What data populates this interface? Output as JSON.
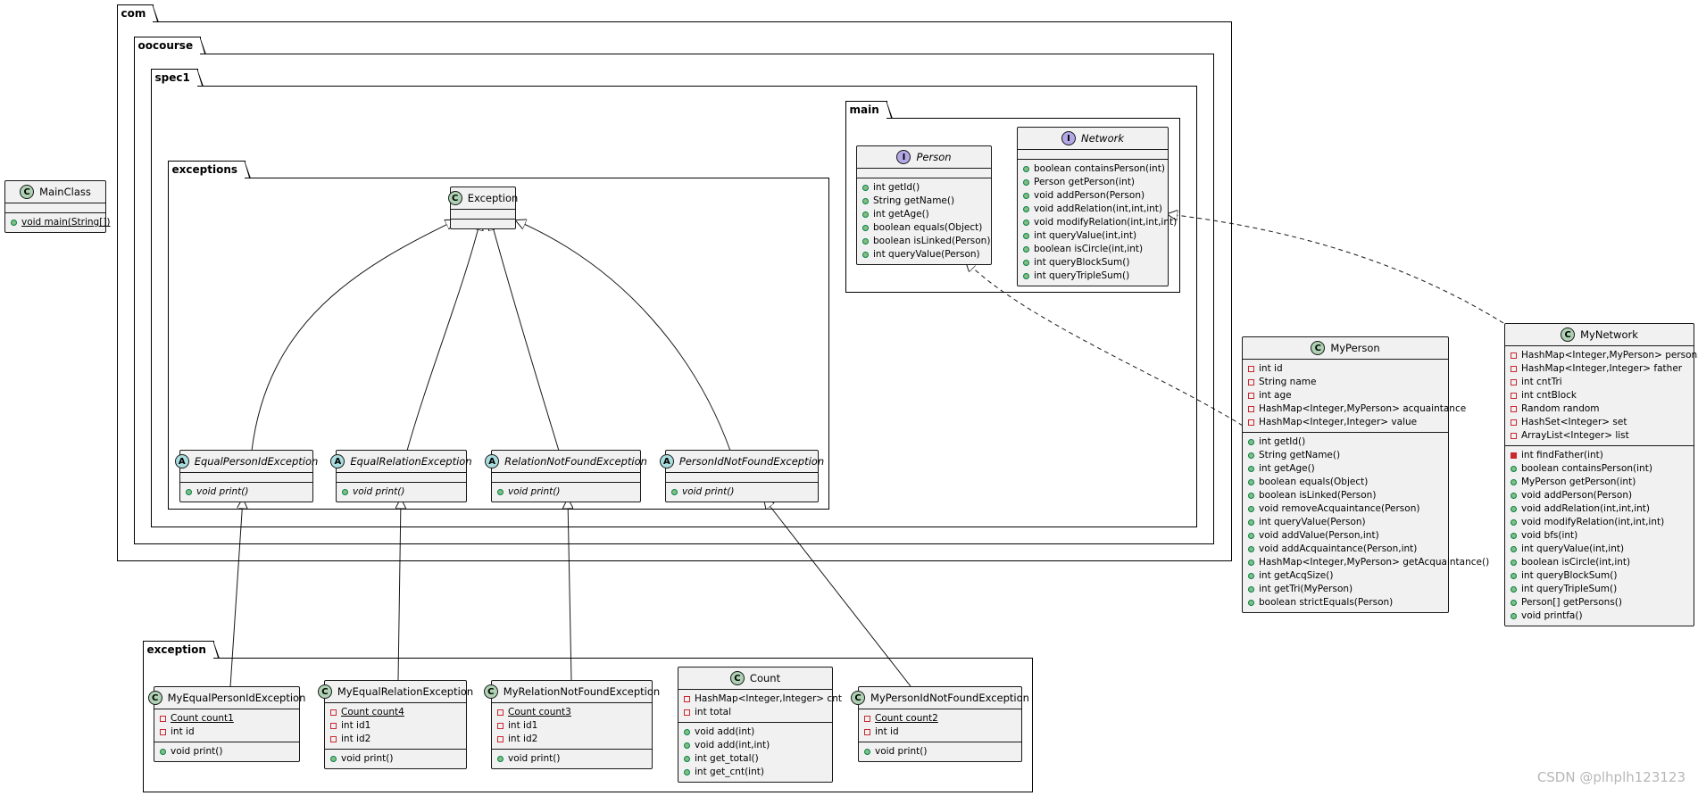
{
  "packages": {
    "com": "com",
    "oocourse": "oocourse",
    "spec1": "spec1",
    "main": "main",
    "exceptions": "exceptions",
    "exception": "exception"
  },
  "classes": {
    "main_class": {
      "kind": "C",
      "name": "MainClass",
      "fields": [],
      "methods": [
        {
          "vis": "pub",
          "text": "void main(String[])",
          "static": true
        }
      ]
    },
    "exception_base": {
      "kind": "C",
      "name": "Exception",
      "fields": [],
      "methods": []
    },
    "person": {
      "kind": "I",
      "name": "Person",
      "fields": [],
      "methods": [
        {
          "vis": "pub",
          "text": "int getId()"
        },
        {
          "vis": "pub",
          "text": "String getName()"
        },
        {
          "vis": "pub",
          "text": "int getAge()"
        },
        {
          "vis": "pub",
          "text": "boolean equals(Object)"
        },
        {
          "vis": "pub",
          "text": "boolean isLinked(Person)"
        },
        {
          "vis": "pub",
          "text": "int queryValue(Person)"
        }
      ]
    },
    "network": {
      "kind": "I",
      "name": "Network",
      "fields": [],
      "methods": [
        {
          "vis": "pub",
          "text": "boolean containsPerson(int)"
        },
        {
          "vis": "pub",
          "text": "Person getPerson(int)"
        },
        {
          "vis": "pub",
          "text": "void addPerson(Person)"
        },
        {
          "vis": "pub",
          "text": "void addRelation(int,int,int)"
        },
        {
          "vis": "pub",
          "text": "void modifyRelation(int,int,int)"
        },
        {
          "vis": "pub",
          "text": "int queryValue(int,int)"
        },
        {
          "vis": "pub",
          "text": "boolean isCircle(int,int)"
        },
        {
          "vis": "pub",
          "text": "int queryBlockSum()"
        },
        {
          "vis": "pub",
          "text": "int queryTripleSum()"
        }
      ]
    },
    "equal_person_id_exception": {
      "kind": "A",
      "name": "EqualPersonIdException",
      "fields": [],
      "methods": [
        {
          "vis": "pub",
          "text": "void print()",
          "abstract": true
        }
      ]
    },
    "equal_relation_exception": {
      "kind": "A",
      "name": "EqualRelationException",
      "fields": [],
      "methods": [
        {
          "vis": "pub",
          "text": "void print()",
          "abstract": true
        }
      ]
    },
    "relation_not_found_exception": {
      "kind": "A",
      "name": "RelationNotFoundException",
      "fields": [],
      "methods": [
        {
          "vis": "pub",
          "text": "void print()",
          "abstract": true
        }
      ]
    },
    "person_id_not_found_exception": {
      "kind": "A",
      "name": "PersonIdNotFoundException",
      "fields": [],
      "methods": [
        {
          "vis": "pub",
          "text": "void print()",
          "abstract": true
        }
      ]
    },
    "my_person": {
      "kind": "C",
      "name": "MyPerson",
      "fields": [
        {
          "vis": "priv",
          "text": "int id"
        },
        {
          "vis": "priv",
          "text": "String name"
        },
        {
          "vis": "priv",
          "text": "int age"
        },
        {
          "vis": "priv",
          "text": "HashMap<Integer,MyPerson> acquaintance"
        },
        {
          "vis": "priv",
          "text": "HashMap<Integer,Integer> value"
        }
      ],
      "methods": [
        {
          "vis": "pub",
          "text": "int getId()"
        },
        {
          "vis": "pub",
          "text": "String getName()"
        },
        {
          "vis": "pub",
          "text": "int getAge()"
        },
        {
          "vis": "pub",
          "text": "boolean equals(Object)"
        },
        {
          "vis": "pub",
          "text": "boolean isLinked(Person)"
        },
        {
          "vis": "pub",
          "text": "void removeAcquaintance(Person)"
        },
        {
          "vis": "pub",
          "text": "int queryValue(Person)"
        },
        {
          "vis": "pub",
          "text": "void addValue(Person,int)"
        },
        {
          "vis": "pub",
          "text": "void addAcquaintance(Person,int)"
        },
        {
          "vis": "pub",
          "text": "HashMap<Integer,MyPerson> getAcquaintance()"
        },
        {
          "vis": "pub",
          "text": "int getAcqSize()"
        },
        {
          "vis": "pub",
          "text": "int getTri(MyPerson)"
        },
        {
          "vis": "pub",
          "text": "boolean strictEquals(Person)"
        }
      ]
    },
    "my_network": {
      "kind": "C",
      "name": "MyNetwork",
      "fields": [
        {
          "vis": "priv",
          "text": "HashMap<Integer,MyPerson> persons"
        },
        {
          "vis": "priv",
          "text": "HashMap<Integer,Integer> father"
        },
        {
          "vis": "priv",
          "text": "int cntTri"
        },
        {
          "vis": "priv",
          "text": "int cntBlock"
        },
        {
          "vis": "priv",
          "text": "Random random"
        },
        {
          "vis": "priv",
          "text": "HashSet<Integer> set"
        },
        {
          "vis": "priv",
          "text": "ArrayList<Integer> list"
        }
      ],
      "methods": [
        {
          "vis": "privm",
          "text": "int findFather(int)"
        },
        {
          "vis": "pub",
          "text": "boolean containsPerson(int)"
        },
        {
          "vis": "pub",
          "text": "MyPerson getPerson(int)"
        },
        {
          "vis": "pub",
          "text": "void addPerson(Person)"
        },
        {
          "vis": "pub",
          "text": "void addRelation(int,int,int)"
        },
        {
          "vis": "pub",
          "text": "void modifyRelation(int,int,int)"
        },
        {
          "vis": "pub",
          "text": "void bfs(int)"
        },
        {
          "vis": "pub",
          "text": "int queryValue(int,int)"
        },
        {
          "vis": "pub",
          "text": "boolean isCircle(int,int)"
        },
        {
          "vis": "pub",
          "text": "int queryBlockSum()"
        },
        {
          "vis": "pub",
          "text": "int queryTripleSum()"
        },
        {
          "vis": "pub",
          "text": "Person[] getPersons()"
        },
        {
          "vis": "pub",
          "text": "void printfa()"
        }
      ]
    },
    "my_equal_person_id_exception": {
      "kind": "C",
      "name": "MyEqualPersonIdException",
      "fields": [
        {
          "vis": "priv",
          "text": "Count count1",
          "static": true
        },
        {
          "vis": "priv",
          "text": "int id"
        }
      ],
      "methods": [
        {
          "vis": "pub",
          "text": "void print()"
        }
      ]
    },
    "my_equal_relation_exception": {
      "kind": "C",
      "name": "MyEqualRelationException",
      "fields": [
        {
          "vis": "priv",
          "text": "Count count4",
          "static": true
        },
        {
          "vis": "priv",
          "text": "int id1"
        },
        {
          "vis": "priv",
          "text": "int id2"
        }
      ],
      "methods": [
        {
          "vis": "pub",
          "text": "void print()"
        }
      ]
    },
    "my_relation_not_found_exception": {
      "kind": "C",
      "name": "MyRelationNotFoundException",
      "fields": [
        {
          "vis": "priv",
          "text": "Count count3",
          "static": true
        },
        {
          "vis": "priv",
          "text": "int id1"
        },
        {
          "vis": "priv",
          "text": "int id2"
        }
      ],
      "methods": [
        {
          "vis": "pub",
          "text": "void print()"
        }
      ]
    },
    "count": {
      "kind": "C",
      "name": "Count",
      "fields": [
        {
          "vis": "priv",
          "text": "HashMap<Integer,Integer> cnt"
        },
        {
          "vis": "priv",
          "text": "int total"
        }
      ],
      "methods": [
        {
          "vis": "pub",
          "text": "void add(int)"
        },
        {
          "vis": "pub",
          "text": "void add(int,int)"
        },
        {
          "vis": "pub",
          "text": "int get_total()"
        },
        {
          "vis": "pub",
          "text": "int get_cnt(int)"
        }
      ]
    },
    "my_person_id_not_found_exception": {
      "kind": "C",
      "name": "MyPersonIdNotFoundException",
      "fields": [
        {
          "vis": "priv",
          "text": "Count count2",
          "static": true
        },
        {
          "vis": "priv",
          "text": "int id"
        }
      ],
      "methods": [
        {
          "vis": "pub",
          "text": "void print()"
        }
      ]
    }
  },
  "watermark": "CSDN @plhplh123123"
}
